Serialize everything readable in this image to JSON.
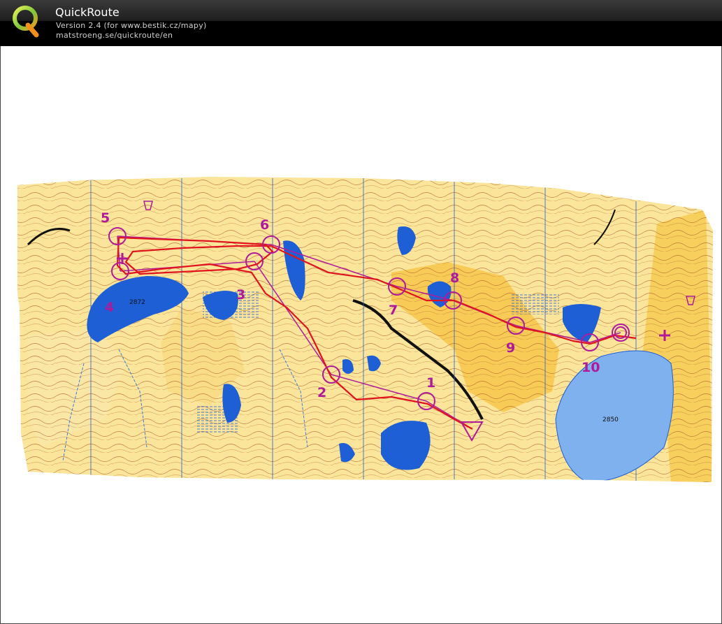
{
  "app": {
    "title": "QuickRoute",
    "version": "Version 2.4  (for www.bestik.cz/mapy)",
    "url": "matstroeng.se/quickroute/en"
  },
  "logo_icon": "quickroute-q-logo-icon",
  "colors": {
    "map_background": "#fbe59a",
    "open_land": "#f7c64a",
    "water": "#1f5fd6",
    "large_lake": "#7fb1ef",
    "route": "#e0141e",
    "course": "#b01a9a",
    "contour": "#b0602a"
  },
  "map": {
    "controls": [
      {
        "label": "1"
      },
      {
        "label": "2"
      },
      {
        "label": "3"
      },
      {
        "label": "4"
      },
      {
        "label": "5"
      },
      {
        "label": "6"
      },
      {
        "label": "7"
      },
      {
        "label": "8"
      },
      {
        "label": "9"
      },
      {
        "label": "10"
      }
    ],
    "lake_labels": [
      "2872",
      "2850"
    ]
  }
}
